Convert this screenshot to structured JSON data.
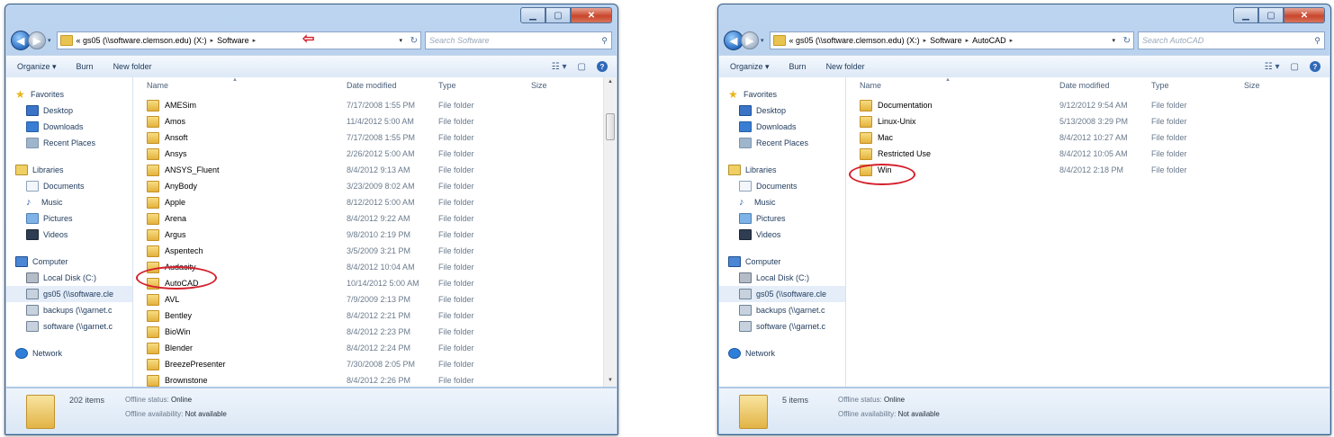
{
  "window1": {
    "address": {
      "crumb1": "«  gs05 (\\\\software.clemson.edu) (X:)",
      "crumb2": "Software",
      "sep": "▸"
    },
    "search_placeholder": "Search Software",
    "toolbar": {
      "organize": "Organize ▾",
      "burn": "Burn",
      "new_folder": "New folder"
    },
    "columns": {
      "name": "Name",
      "date": "Date modified",
      "type": "Type",
      "size": "Size"
    },
    "rows": [
      {
        "name": "AMESim",
        "date": "7/17/2008 1:55 PM",
        "type": "File folder"
      },
      {
        "name": "Amos",
        "date": "11/4/2012 5:00 AM",
        "type": "File folder"
      },
      {
        "name": "Ansoft",
        "date": "7/17/2008 1:55 PM",
        "type": "File folder"
      },
      {
        "name": "Ansys",
        "date": "2/26/2012 5:00 AM",
        "type": "File folder"
      },
      {
        "name": "ANSYS_Fluent",
        "date": "8/4/2012 9:13 AM",
        "type": "File folder"
      },
      {
        "name": "AnyBody",
        "date": "3/23/2009 8:02 AM",
        "type": "File folder"
      },
      {
        "name": "Apple",
        "date": "8/12/2012 5:00 AM",
        "type": "File folder"
      },
      {
        "name": "Arena",
        "date": "8/4/2012 9:22 AM",
        "type": "File folder"
      },
      {
        "name": "Argus",
        "date": "9/8/2010 2:19 PM",
        "type": "File folder"
      },
      {
        "name": "Aspentech",
        "date": "3/5/2009 3:21 PM",
        "type": "File folder"
      },
      {
        "name": "Audacity",
        "date": "8/4/2012 10:04 AM",
        "type": "File folder"
      },
      {
        "name": "AutoCAD",
        "date": "10/14/2012 5:00 AM",
        "type": "File folder"
      },
      {
        "name": "AVL",
        "date": "7/9/2009 2:13 PM",
        "type": "File folder"
      },
      {
        "name": "Bentley",
        "date": "8/4/2012 2:21 PM",
        "type": "File folder"
      },
      {
        "name": "BioWin",
        "date": "8/4/2012 2:23 PM",
        "type": "File folder"
      },
      {
        "name": "Blender",
        "date": "8/4/2012 2:24 PM",
        "type": "File folder"
      },
      {
        "name": "BreezePresenter",
        "date": "7/30/2008 2:05 PM",
        "type": "File folder"
      },
      {
        "name": "Brownstone",
        "date": "8/4/2012 2:26 PM",
        "type": "File folder"
      }
    ],
    "status": {
      "items": "202 items",
      "offline_label": "Offline status:",
      "offline_value": "Online",
      "avail_label": "Offline availability:",
      "avail_value": "Not available"
    }
  },
  "window2": {
    "address": {
      "crumb1": "«  gs05 (\\\\software.clemson.edu) (X:)",
      "crumb2": "Software",
      "crumb3": "AutoCAD",
      "sep": "▸"
    },
    "search_placeholder": "Search AutoCAD",
    "toolbar": {
      "organize": "Organize ▾",
      "burn": "Burn",
      "new_folder": "New folder"
    },
    "columns": {
      "name": "Name",
      "date": "Date modified",
      "type": "Type",
      "size": "Size"
    },
    "rows": [
      {
        "name": "Documentation",
        "date": "9/12/2012 9:54 AM",
        "type": "File folder"
      },
      {
        "name": "Linux-Unix",
        "date": "5/13/2008 3:29 PM",
        "type": "File folder"
      },
      {
        "name": "Mac",
        "date": "8/4/2012 10:27 AM",
        "type": "File folder"
      },
      {
        "name": "Restricted Use",
        "date": "8/4/2012 10:05 AM",
        "type": "File folder"
      },
      {
        "name": "Win",
        "date": "8/4/2012 2:18 PM",
        "type": "File folder"
      }
    ],
    "status": {
      "items": "5 items",
      "offline_label": "Offline status:",
      "offline_value": "Online",
      "avail_label": "Offline availability:",
      "avail_value": "Not available"
    }
  },
  "nav": {
    "favorites": "Favorites",
    "desktop": "Desktop",
    "downloads": "Downloads",
    "recent": "Recent Places",
    "libraries": "Libraries",
    "documents": "Documents",
    "music": "Music",
    "pictures": "Pictures",
    "videos": "Videos",
    "computer": "Computer",
    "local_disk": "Local Disk (C:)",
    "gs05": "gs05 (\\\\software.cle",
    "backups": "backups (\\\\garnet.c",
    "software": "software (\\\\garnet.c",
    "network": "Network"
  },
  "colors": {
    "highlight": "#d4202c",
    "accent": "#2f69b8"
  }
}
